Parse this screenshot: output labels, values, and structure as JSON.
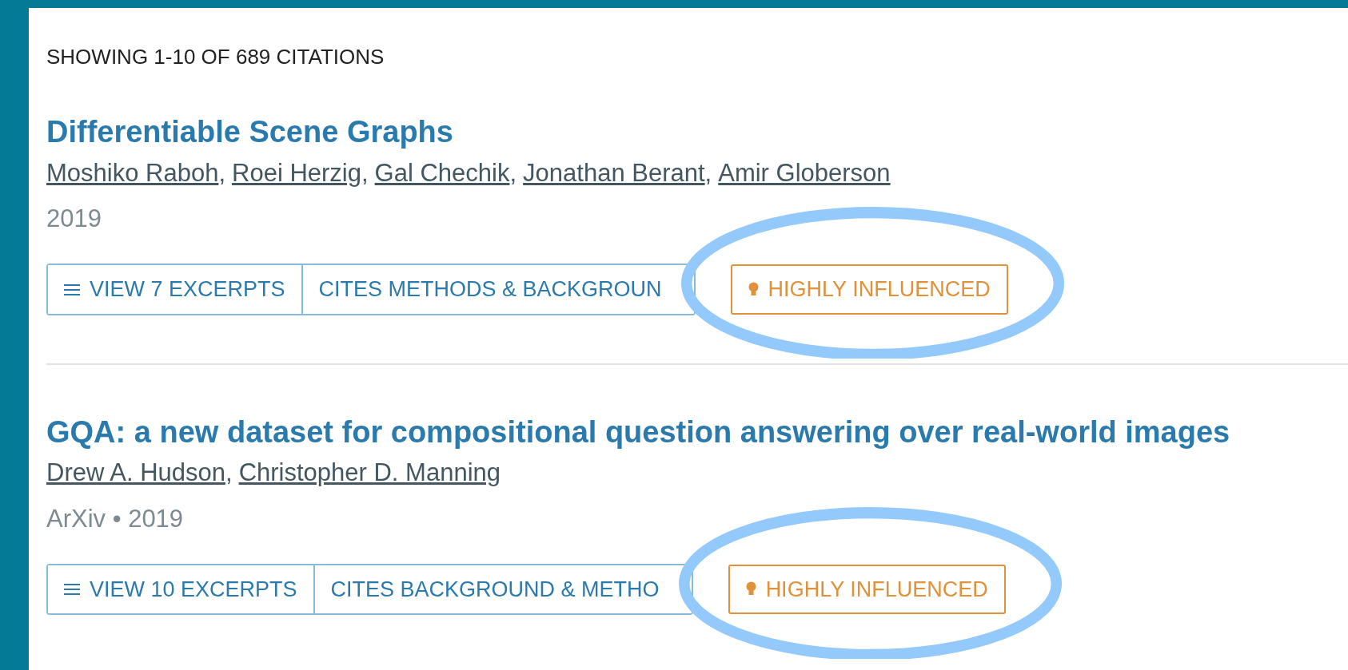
{
  "results_count": "SHOWING 1-10 OF 689 CITATIONS",
  "citations": [
    {
      "title": "Differentiable Scene Graphs",
      "authors": [
        {
          "name": "Moshiko Raboh",
          "separator": ","
        },
        {
          "name": "Roei Herzig",
          "separator": ","
        },
        {
          "name": "Gal Chechik",
          "separator": ","
        },
        {
          "name": "Jonathan Berant",
          "separator": ","
        },
        {
          "name": "Amir Globerson"
        }
      ],
      "meta": "2019",
      "excerpts_button": "VIEW 7 EXCERPTS",
      "intent": "CITES METHODS & BACKGROUN",
      "badge": {
        "label": "HIGHLY INFLUENCED",
        "circled": true
      }
    },
    {
      "title": "GQA: a new dataset for compositional question answering over real-world images",
      "authors": [
        {
          "name": "Drew A. Hudson",
          "separator": ","
        },
        {
          "name": "Christopher D. Manning"
        }
      ],
      "meta": "ArXiv • 2019",
      "excerpts_button": "VIEW 10 EXCERPTS",
      "intent": "CITES BACKGROUND & METHO",
      "badge": {
        "label": "HIGHLY INFLUENCED",
        "circled": true
      }
    }
  ]
}
